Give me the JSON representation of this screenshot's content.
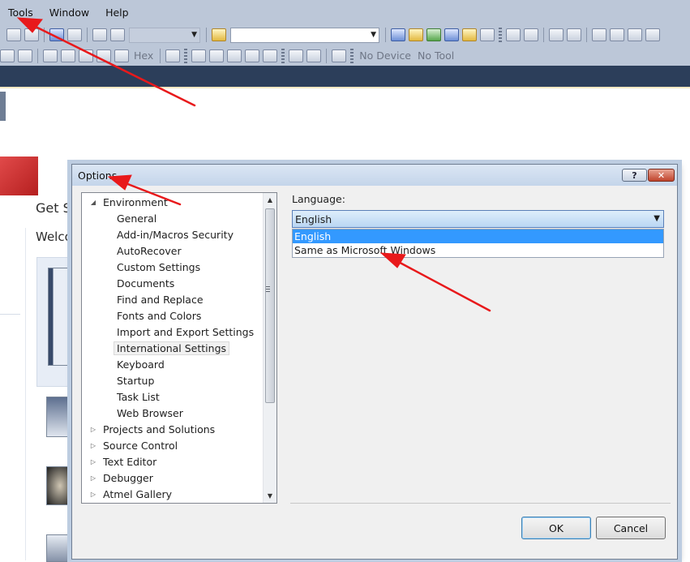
{
  "menubar": {
    "items": [
      "Tools",
      "Window",
      "Help"
    ]
  },
  "toolbar": {
    "hex_label": "Hex",
    "no_device_label": "No Device",
    "no_tool_label": "No Tool"
  },
  "start_page": {
    "heading": "Get St",
    "welcome": "Welco"
  },
  "dialog": {
    "title": "Options",
    "help_label": "?",
    "close_label": "✕",
    "tree": {
      "root_expanded": "Environment",
      "children": [
        "General",
        "Add-in/Macros Security",
        "AutoRecover",
        "Custom Settings",
        "Documents",
        "Find and Replace",
        "Fonts and Colors",
        "Import and Export Settings",
        "International Settings",
        "Keyboard",
        "Startup",
        "Task List",
        "Web Browser"
      ],
      "selected": "International Settings",
      "collapsed_roots": [
        "Projects and Solutions",
        "Source Control",
        "Text Editor",
        "Debugger",
        "Atmel Gallery"
      ]
    },
    "language": {
      "label": "Language:",
      "selected": "English",
      "options": [
        "English",
        "Same as Microsoft Windows"
      ]
    },
    "ok_label": "OK",
    "cancel_label": "Cancel"
  },
  "colors": {
    "annotation_arrow": "#e8191b",
    "selection": "#3399ff",
    "nav_band": "#2c3e5a"
  }
}
